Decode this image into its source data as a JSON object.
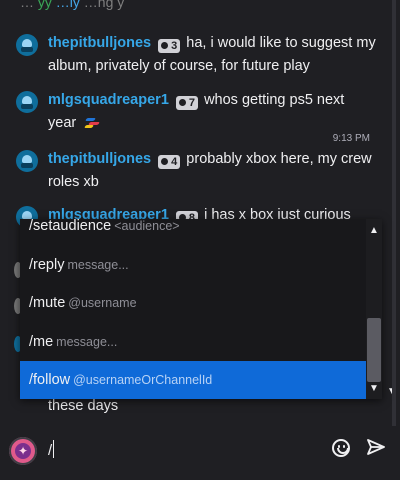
{
  "chat": {
    "top_fragment": {
      "left": "…",
      "green": "yy",
      "blue": "…ly",
      "right": "…ng y"
    },
    "messages": [
      {
        "user": "thepitbulljones",
        "badge": "3",
        "text": "ha, i would like to suggest my album, privately of course, for future play"
      },
      {
        "user": "mlgsquadreaper1",
        "badge": "7",
        "text": "whos getting ps5 next year"
      },
      {
        "user": "thepitbulljones",
        "badge": "4",
        "text": "probably xbox here, my crew roles xb"
      },
      {
        "user": "mlgsquadreaper1",
        "badge": "8",
        "text": "i has x box just curious"
      }
    ],
    "timestamp": "9:13 PM",
    "partial_text_below": "these days"
  },
  "autocomplete": {
    "items": [
      {
        "command": "/setaudience",
        "arg": "<audience>"
      },
      {
        "command": "/reply",
        "arg": "message..."
      },
      {
        "command": "/mute",
        "arg": "@username"
      },
      {
        "command": "/me",
        "arg": "message..."
      },
      {
        "command": "/follow",
        "arg": "@usernameOrChannelId"
      }
    ],
    "selected_index": 4
  },
  "input": {
    "value": "/"
  },
  "icons": {
    "logo": "app-logo-icon",
    "emoji": "emoji-icon",
    "send": "send-icon",
    "badge": "badge-dot-icon",
    "ps": "playstation-icon"
  },
  "colors": {
    "username": "#36a7e8",
    "selected_item": "#0f6ad8",
    "background": "#1f1f23"
  }
}
